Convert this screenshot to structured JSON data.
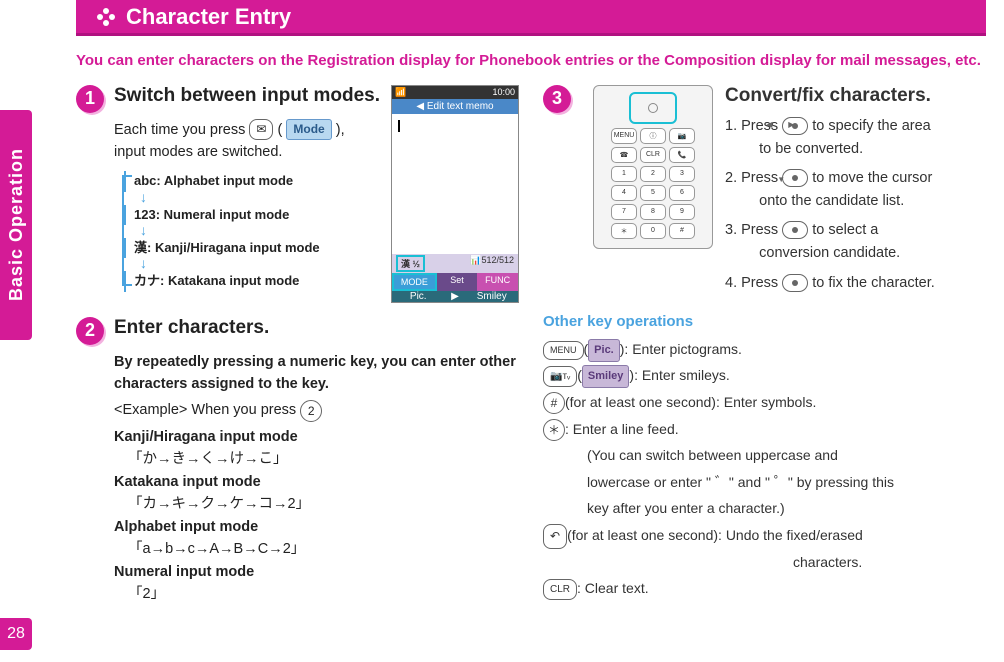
{
  "sidebar": {
    "tab_label": "Basic Operation",
    "page_number": "28"
  },
  "header": {
    "title": "Character Entry"
  },
  "intro": "You can enter characters on the Registration display for Phonebook entries or the Composition display for mail messages, etc.",
  "step1": {
    "num": "1",
    "title": "Switch between input modes.",
    "line1_a": "Each time you press ",
    "line1_b": "(",
    "line1_btn": "Mode",
    "line1_c": "),",
    "line2": "input modes are switched.",
    "flow": {
      "a": "abc: Alphabet input mode",
      "b": "123: Numeral input mode",
      "c": "漢: Kanji/Hiragana input mode",
      "d": "カナ: Katakana input mode"
    }
  },
  "phone": {
    "time": "10:00",
    "title": "Edit text memo",
    "status_left": "漢",
    "status_mid": "½",
    "status_right": "512/512",
    "sk_mode": "MODE",
    "sk_set": "Set",
    "sk_func": "FUNC",
    "sk_pic": "Pic.",
    "sk_smiley": "Smiley"
  },
  "step2": {
    "num": "2",
    "title": "Enter characters.",
    "sub": "By repeatedly pressing a numeric key, you can enter other characters assigned to the key.",
    "ex_label": "<Example> When you press ",
    "ex_key": "2",
    "m1_label": "Kanji/Hiragana input mode",
    "m1_seq": "「か→き→く→け→こ」",
    "m2_label": "Katakana input mode",
    "m2_seq": "「カ→キ→ク→ケ→コ→2」",
    "m3_label": "Alphabet input mode",
    "m3_seq": "「a→b→c→A→B→C→2」",
    "m4_label": "Numeral input mode",
    "m4_seq": "「2」"
  },
  "step3": {
    "num": "3",
    "title": "Convert/fix characters.",
    "items": [
      "1. Press   to specify the area to be converted.",
      "2. Press   to move the cursor onto the candidate list.",
      "3. Press   to select a conversion candidate.",
      "4. Press   to fix the character."
    ],
    "i1a": "1. Press ",
    "i1b": " to specify the area",
    "i1c": "to be converted.",
    "i2a": "2. Press ",
    "i2b": " to move the cursor",
    "i2c": "onto the candidate list.",
    "i3a": "3. Press ",
    "i3b": " to select a",
    "i3c": "conversion candidate.",
    "i4a": "4. Press ",
    "i4b": " to fix the character."
  },
  "other": {
    "heading": "Other key operations",
    "op1_key": "MENU",
    "op1_btn": "Pic.",
    "op1_text": ": Enter pictograms.",
    "op2_btn": "Smiley",
    "op2_text": ": Enter smileys.",
    "op3_key": "#",
    "op3_text": "(for at least one second): Enter symbols.",
    "op4_key": "＊",
    "op4_text": ": Enter a line feed.",
    "op4_note1": "(You can switch between uppercase and",
    "op4_note2": "lowercase or enter \" ゛\" and \" ゜\" by pressing this",
    "op4_note3": "key after you enter a character.)",
    "op5_text": "(for at least one second): Undo the fixed/erased",
    "op5_text2": "characters.",
    "op6_key": "CLR",
    "op6_text": ": Clear text."
  }
}
